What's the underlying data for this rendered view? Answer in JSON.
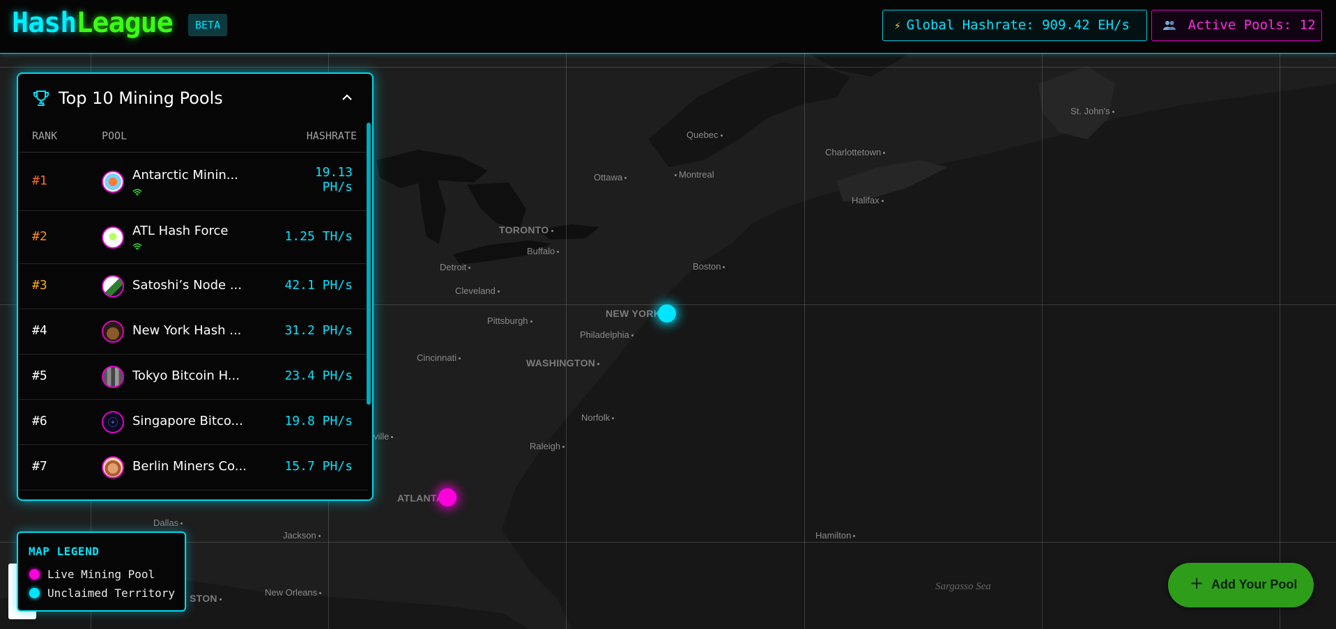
{
  "header": {
    "logo_part1": "Hash",
    "logo_part2": "League",
    "badge": "BETA",
    "hashrate_icon": "lightning-icon",
    "hashrate_text": "Global Hashrate: 909.42 EH/s",
    "pools_icon": "users-icon",
    "pools_text": "Active Pools: 12"
  },
  "leaderboard": {
    "title": "Top 10 Mining Pools",
    "trophy_icon": "trophy-icon",
    "collapse_icon": "chevron-up-icon",
    "columns": {
      "rank": "RANK",
      "pool": "POOL",
      "hashrate": "HASHRATE"
    },
    "rows": [
      {
        "rank": "#1",
        "name": "Antarctic Minin...",
        "hashrate_line1": "19.13",
        "hashrate_line2": "PH/s",
        "live": true,
        "rank_color": "#ff6a1a"
      },
      {
        "rank": "#2",
        "name": "ATL Hash Force",
        "hashrate": "1.25 TH/s",
        "live": true,
        "rank_color": "#ff8c1a"
      },
      {
        "rank": "#3",
        "name": "Satoshi’s Node ...",
        "hashrate": "42.1 PH/s",
        "live": false,
        "rank_color": "#f5a623"
      },
      {
        "rank": "#4",
        "name": "New York Hash ...",
        "hashrate": "31.2 PH/s",
        "live": false,
        "rank_color": "#ffffff"
      },
      {
        "rank": "#5",
        "name": "Tokyo Bitcoin H...",
        "hashrate": "23.4 PH/s",
        "live": false,
        "rank_color": "#ffffff"
      },
      {
        "rank": "#6",
        "name": "Singapore Bitco...",
        "hashrate": "19.8 PH/s",
        "live": false,
        "rank_color": "#ffffff"
      },
      {
        "rank": "#7",
        "name": "Berlin Miners Co...",
        "hashrate": "15.7 PH/s",
        "live": false,
        "rank_color": "#ffffff"
      }
    ]
  },
  "legend": {
    "title": "MAP LEGEND",
    "items": [
      {
        "label": "Live Mining Pool",
        "color": "#ff00dd"
      },
      {
        "label": "Unclaimed Territory",
        "color": "#00e5ff"
      }
    ]
  },
  "map": {
    "cities": {
      "st_johns": "St. John's",
      "quebec": "Quebec",
      "charlottetown": "Charlottetown",
      "ottawa": "Ottawa",
      "montreal": "Montreal",
      "halifax": "Halifax",
      "toronto": "TORONTO",
      "buffalo": "Buffalo",
      "detroit": "Detroit",
      "boston": "Boston",
      "cleveland": "Cleveland",
      "new_york": "NEW YORK",
      "pittsburgh": "Pittsburgh",
      "philadelphia": "Philadelphia",
      "cincinnati": "Cincinnati",
      "washington": "WASHINGTON",
      "norfolk": "Norfolk",
      "raleigh": "Raleigh",
      "atlanta": "ATLANTA",
      "dallas": "Dallas",
      "jackson": "Jackson",
      "hamilton": "Hamilton",
      "new_orleans": "New Orleans",
      "houston_fragment": "STON",
      "nashville_fragment": "ville",
      "sargasso": "Sargasso Sea"
    }
  },
  "actions": {
    "add_pool": "Add Your Pool",
    "add_icon": "plus-icon"
  }
}
